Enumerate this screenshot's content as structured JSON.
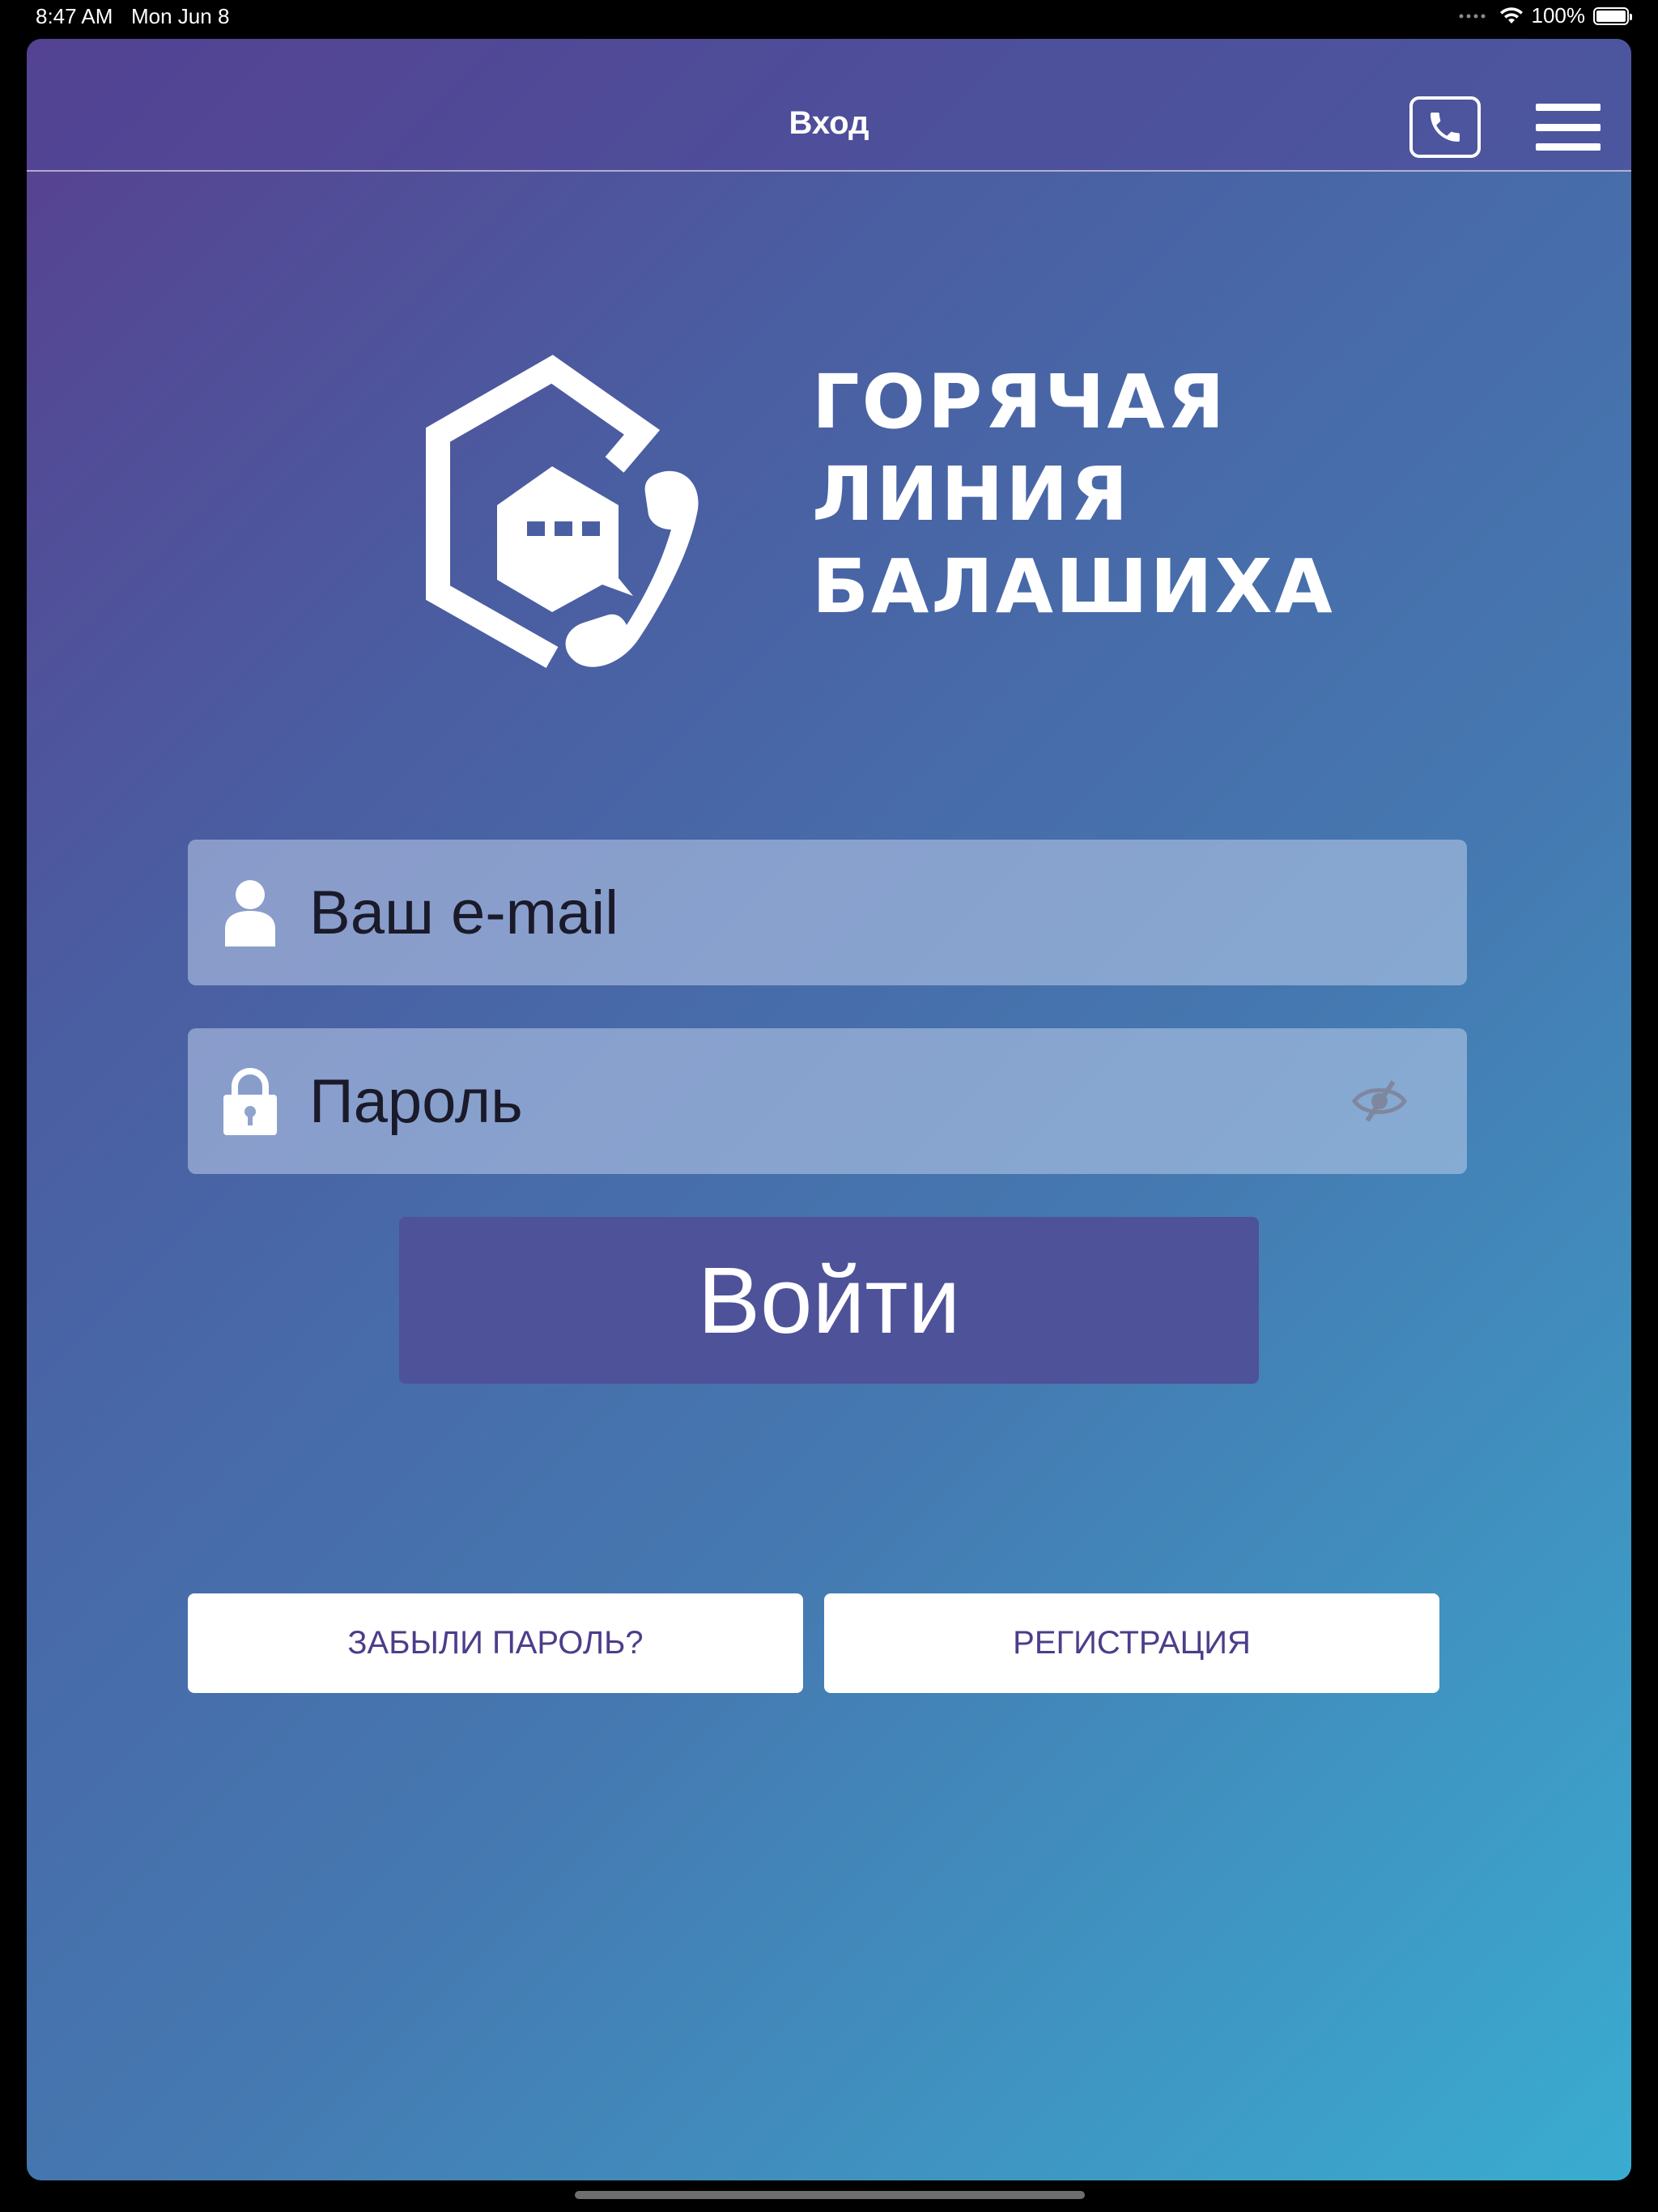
{
  "status_bar": {
    "time": "8:47 AM",
    "date": "Mon Jun 8",
    "battery_percent": "100%",
    "wifi_icon": "wifi-icon",
    "battery_level": 1.0
  },
  "nav_bar": {
    "title": "Вход",
    "call_icon": "phone-icon",
    "menu_icon": "hamburger-menu-icon"
  },
  "logo": {
    "line1": "ГОРЯЧАЯ",
    "line2": "ЛИНИЯ",
    "line3": "БАЛАШИХА",
    "mark_icon": "hexagon-chat-phone-logo"
  },
  "form": {
    "email": {
      "placeholder": "Ваш e-mail",
      "value": "",
      "icon": "user-icon"
    },
    "password": {
      "placeholder": "Пароль",
      "value": "",
      "icon": "lock-icon",
      "toggle_icon": "eye-slash-icon"
    },
    "login_label": "Войти"
  },
  "links": {
    "forgot_label": "ЗАБЫЛИ ПАРОЛЬ?",
    "register_label": "РЕГИСТРАЦИЯ"
  },
  "colors": {
    "gradient_start": "#583f8f",
    "gradient_end": "#3aacd0",
    "button_primary": "#4e5298",
    "secondary_text": "#4d3d8a"
  }
}
